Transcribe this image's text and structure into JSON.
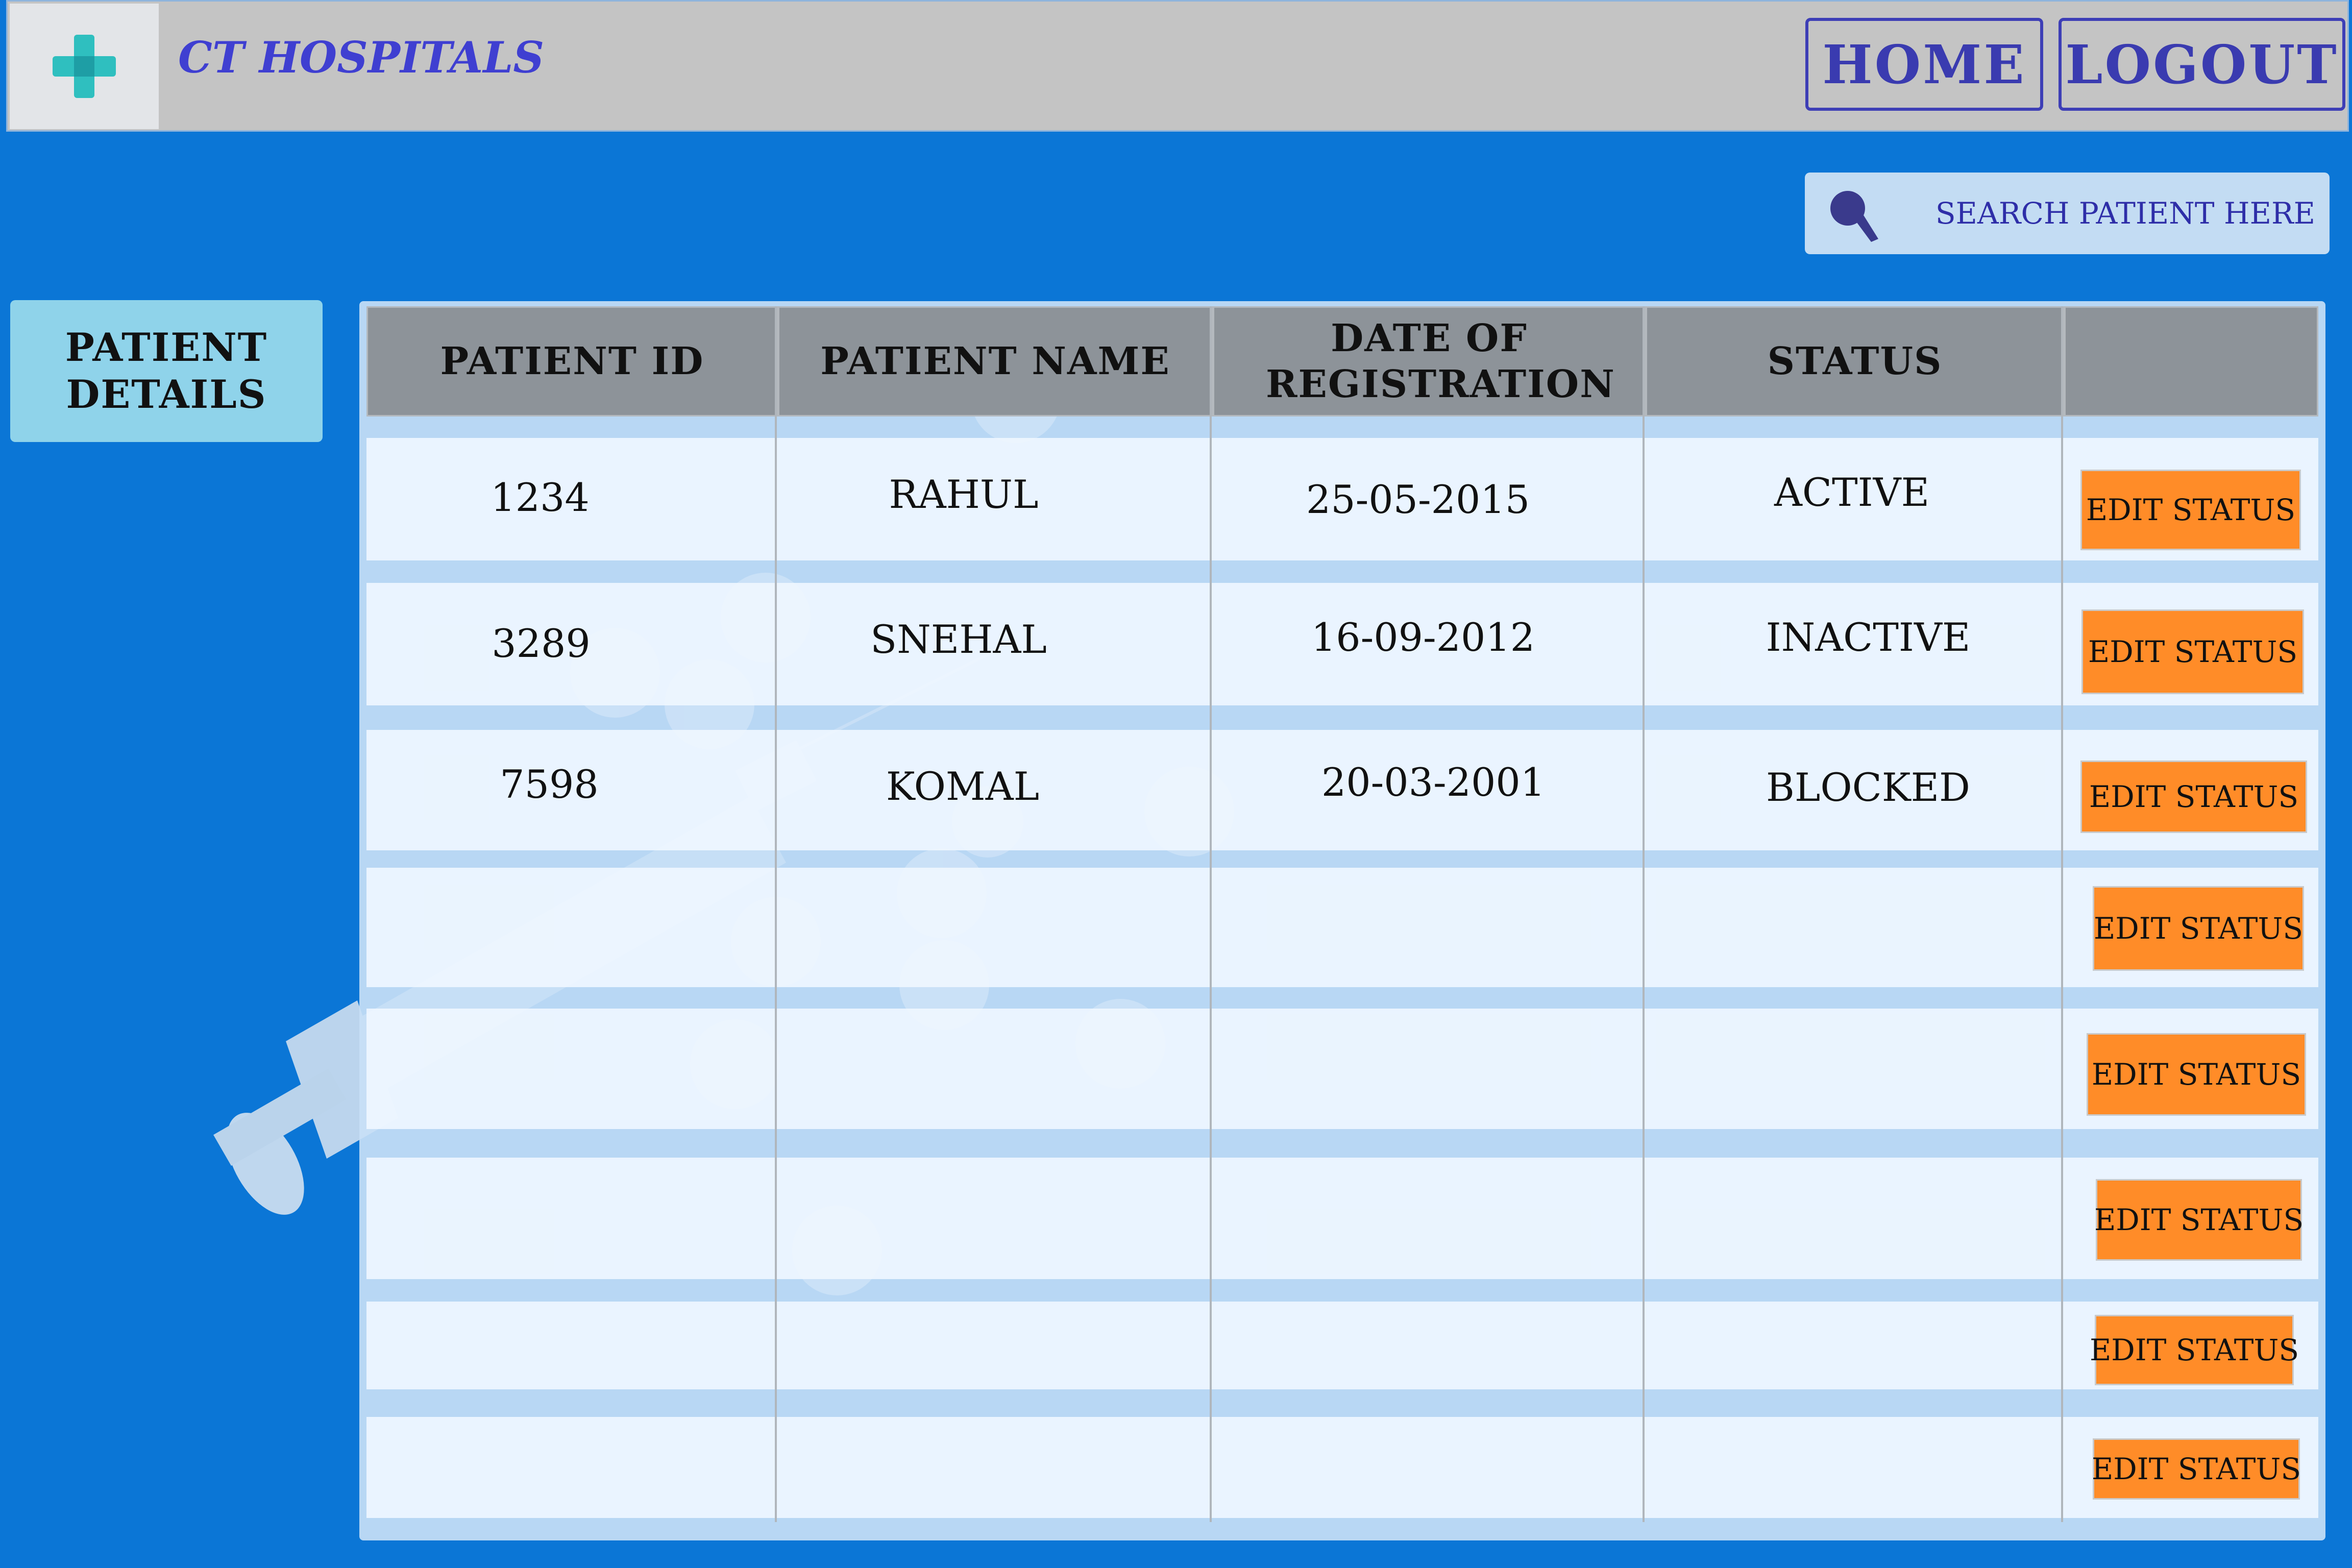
{
  "header": {
    "brand": "CT HOSPITALS",
    "home_label": "HOME",
    "logout_label": "LOGOUT",
    "logo_icon": "medical-cross-icon"
  },
  "search": {
    "placeholder": "SEARCH PATIENT HERE",
    "icon": "search-icon"
  },
  "sidebar": {
    "patient_details_label": "PATIENT DETAILS"
  },
  "table": {
    "columns": [
      "PATIENT ID",
      "PATIENT NAME",
      "DATE OF REGISTRATION",
      "STATUS"
    ],
    "rows": [
      {
        "id": "1234",
        "name": "RAHUL",
        "date": "25-05-2015",
        "status": "ACTIVE",
        "action": "EDIT STATUS"
      },
      {
        "id": "3289",
        "name": "SNEHAL",
        "date": "16-09-2012",
        "status": "INACTIVE",
        "action": "EDIT STATUS"
      },
      {
        "id": "7598",
        "name": "KOMAL",
        "date": "20-03-2001",
        "status": "BLOCKED",
        "action": "EDIT STATUS"
      },
      {
        "id": "",
        "name": "",
        "date": "",
        "status": "",
        "action": "EDIT STATUS"
      },
      {
        "id": "",
        "name": "",
        "date": "",
        "status": "",
        "action": "EDIT STATUS"
      },
      {
        "id": "",
        "name": "",
        "date": "",
        "status": "",
        "action": "EDIT STATUS"
      },
      {
        "id": "",
        "name": "",
        "date": "",
        "status": "",
        "action": "EDIT STATUS"
      },
      {
        "id": "",
        "name": "",
        "date": "",
        "status": "",
        "action": "EDIT STATUS"
      }
    ]
  },
  "colors": {
    "background": "#0a78d8",
    "header_bar": "#c4c4c4",
    "brand_text": "#3f3fd1",
    "edit_button": "#ff8c28",
    "side_button": "#8fd3ea"
  }
}
